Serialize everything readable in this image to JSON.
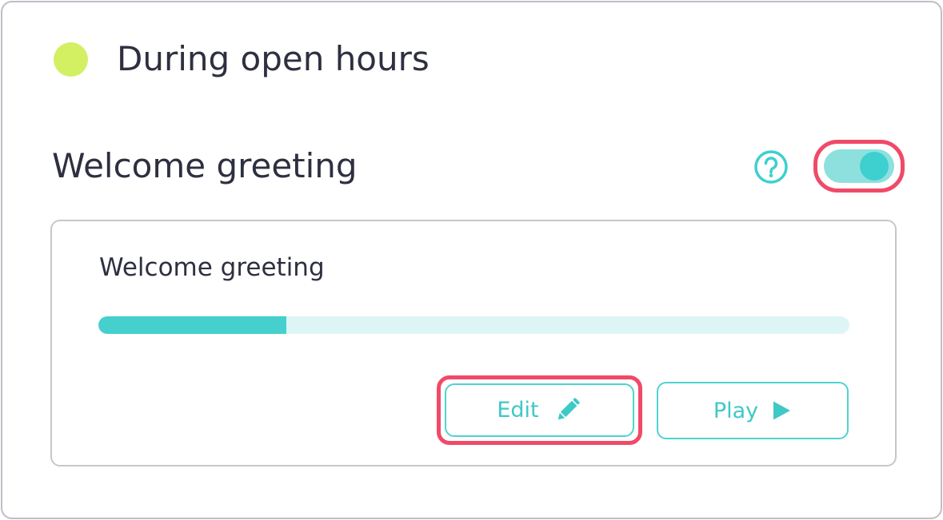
{
  "status": {
    "label": "During open hours",
    "indicator_color": "#d3f063"
  },
  "section": {
    "title": "Welcome greeting",
    "help_icon": "question-circle-icon",
    "toggle": {
      "state": "on",
      "highlighted": true
    }
  },
  "greeting_card": {
    "title": "Welcome greeting",
    "progress_fraction": 0.25,
    "edit_label": "Edit",
    "edit_icon": "pencil-icon",
    "edit_highlighted": true,
    "play_label": "Play",
    "play_icon": "play-icon"
  },
  "colors": {
    "accent": "#45cfcd",
    "highlight": "#f04a68",
    "text": "#2e2f40"
  }
}
